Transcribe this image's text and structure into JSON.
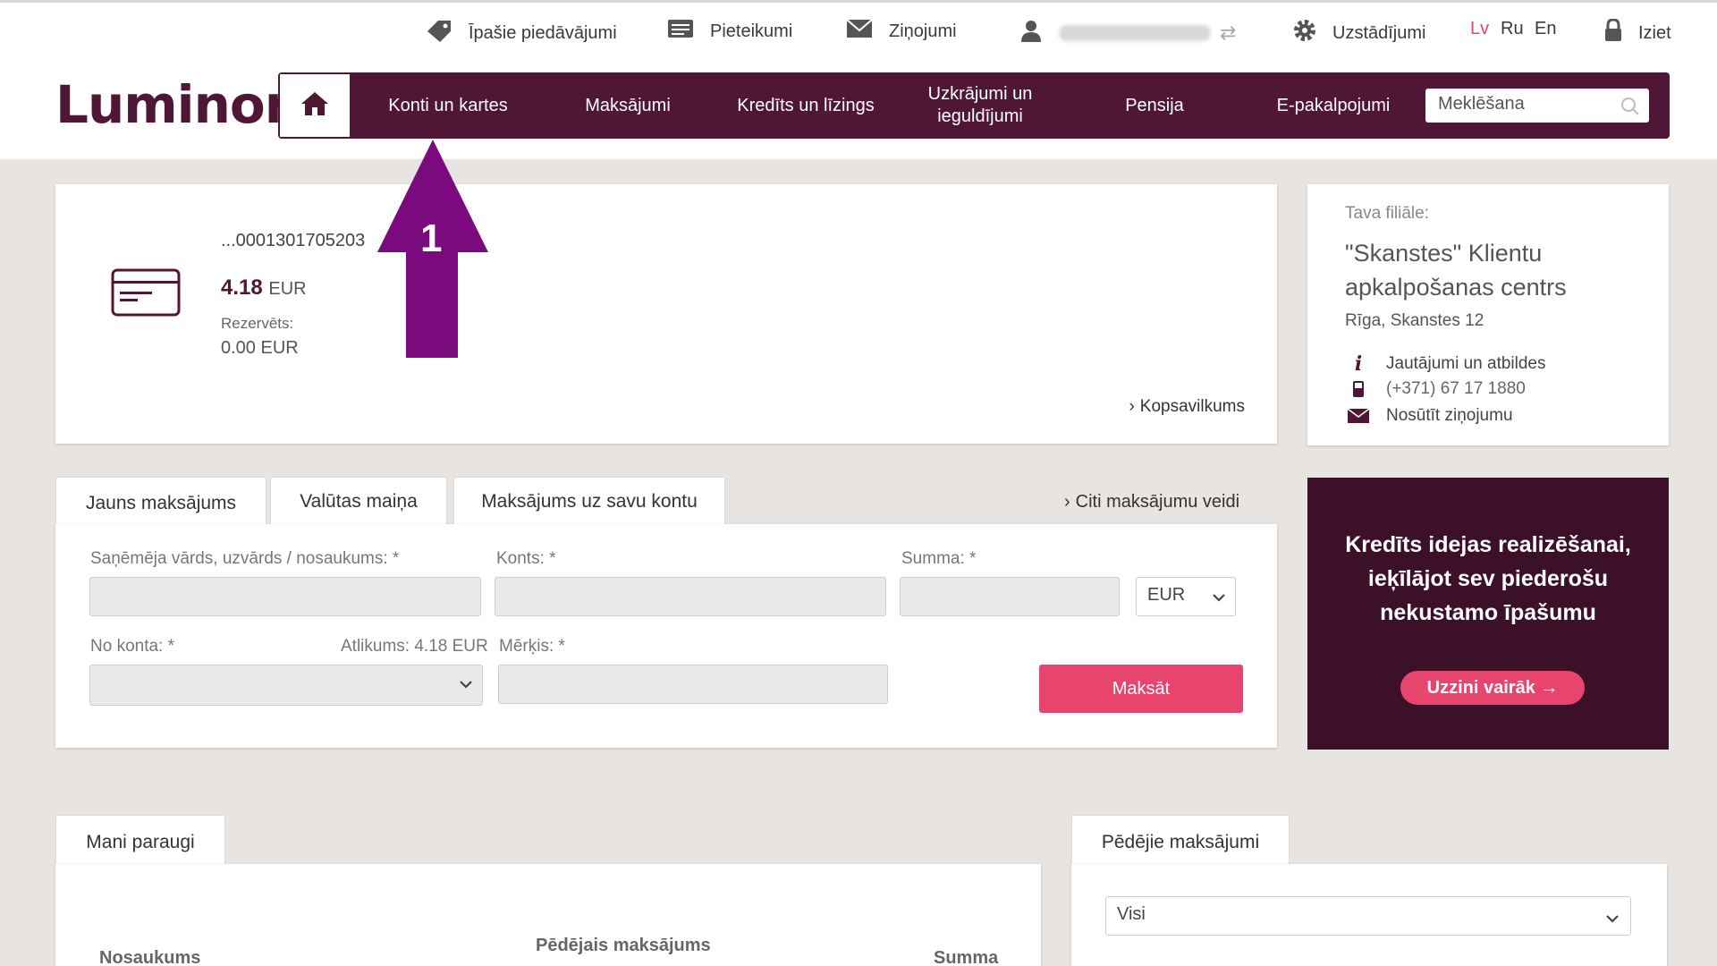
{
  "header": {
    "util": {
      "offers": "Īpašie piedāvājumi",
      "applications": "Pieteikumi",
      "messages": "Ziņojumi",
      "settings": "Uzstādījumi",
      "lang_lv": "Lv",
      "lang_ru": "Ru",
      "lang_en": "En",
      "logout": "Iziet"
    },
    "logo": "Luminor",
    "nav": {
      "accounts": "Konti un kartes",
      "payments": "Maksājumi",
      "credit": "Kredīts un līzings",
      "savings": "Uzkrājumi un ieguldījumi",
      "pension": "Pensija",
      "eservices": "E-pakalpojumi"
    },
    "search_placeholder": "Meklēšana"
  },
  "account": {
    "number": "...0001301705203",
    "balance": "4.18",
    "currency": "EUR",
    "reserved_label": "Rezervēts:",
    "reserved_value": "0.00 EUR",
    "summary_link": "Kopsavilkums"
  },
  "branch": {
    "label": "Tava filiāle:",
    "name": "\"Skanstes\" Klientu apkalpošanas centrs",
    "address": "Rīga, Skanstes 12",
    "faq": "Jautājumi un atbildes",
    "phone": "(+371) 67 17 1880",
    "message": "Nosūtīt ziņojumu"
  },
  "payment": {
    "tabs": [
      "Jauns maksājums",
      "Valūtas maiņa",
      "Maksājums uz savu kontu"
    ],
    "other_link": "Citi maksājumu veidi",
    "recipient_label": "Saņēmēja vārds, uzvārds / nosaukums: *",
    "account_label": "Konts: *",
    "amount_label": "Summa: *",
    "currency": "EUR",
    "from_label": "No konta: *",
    "balance_label": "Atlikums: 4.18 EUR",
    "purpose_label": "Mērķis: *",
    "pay_button": "Maksāt"
  },
  "promo": {
    "text": "Kredīts idejas realizēšanai, ieķīlājot sev piederošu nekustamo īpašumu",
    "button": "Uzzini vairāk →"
  },
  "templates": {
    "tab": "Mani paraugi",
    "col_name": "Nosaukums",
    "col_last": "Pēdējais maksājums",
    "col_sum": "Summa"
  },
  "last_payments": {
    "tab": "Pēdējie maksājumi",
    "filter": "Visi"
  },
  "annotation": {
    "number": "1",
    "color": "#7b0a7e"
  }
}
